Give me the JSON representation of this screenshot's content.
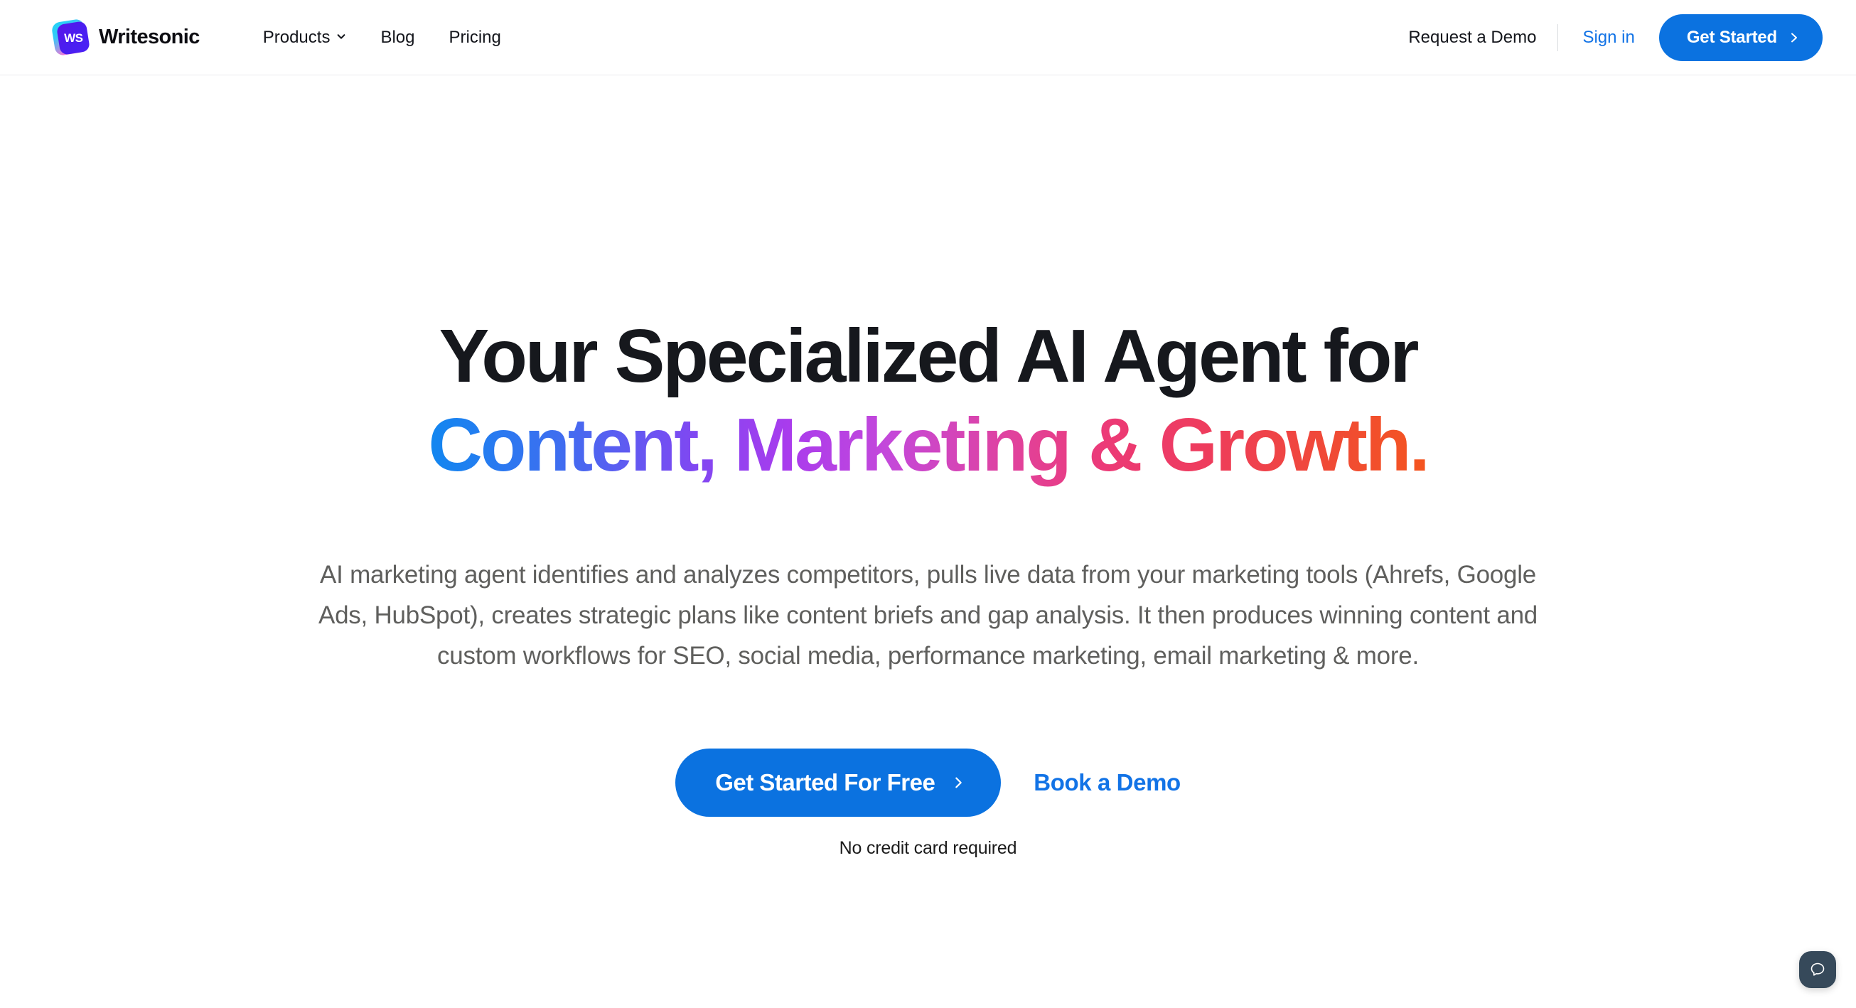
{
  "header": {
    "brand": {
      "logo_text": "WS",
      "name": "Writesonic"
    },
    "nav": [
      {
        "label": "Products",
        "has_dropdown": true,
        "icon": "chevron-down-icon"
      },
      {
        "label": "Blog",
        "has_dropdown": false
      },
      {
        "label": "Pricing",
        "has_dropdown": false
      }
    ],
    "request_demo_label": "Request a Demo",
    "signin_label": "Sign in",
    "get_started_label": "Get Started",
    "get_started_icon": "chevron-right-icon"
  },
  "hero": {
    "title_line1": "Your Specialized AI Agent for",
    "title_line2": "Content, Marketing & Growth.",
    "subtitle": "AI marketing agent identifies and analyzes competitors, pulls live data from your marketing tools (Ahrefs, Google Ads, HubSpot), creates strategic plans like content briefs and gap analysis. It then produces winning content and custom workflows for SEO, social media, performance marketing, email marketing & more.",
    "primary_cta_label": "Get Started For Free",
    "primary_cta_icon": "chevron-right-icon",
    "secondary_cta_label": "Book a Demo",
    "note": "No credit card required"
  },
  "chat": {
    "icon": "chat-bubble-icon",
    "aria_label": "Open chat"
  },
  "colors": {
    "brand_blue": "#0b72e0",
    "link_blue": "#1273e6",
    "text_dark": "#16181d",
    "text_muted": "#5f5f5d",
    "gradient_start": "#1187f0",
    "gradient_mid": "#c448da",
    "gradient_end": "#f4551f",
    "chat_bg": "#36495a",
    "header_border": "#e9ebee"
  }
}
